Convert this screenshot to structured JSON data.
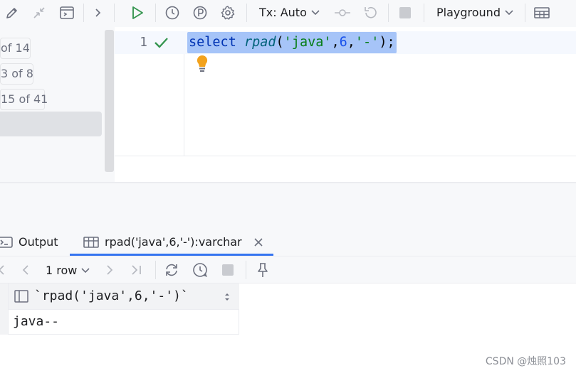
{
  "toolbar": {
    "tx_mode": "Tx: Auto",
    "session": "Playground",
    "colors": {
      "run": "#369650",
      "icon": "#6c707e",
      "disabled": "#b5b8bf"
    }
  },
  "structure_panel": {
    "counts": [
      "of 14",
      "3 of 8",
      "15 of 41"
    ]
  },
  "editor": {
    "line_number": "1",
    "code_tokens": [
      {
        "text": "select",
        "type": "kw"
      },
      {
        "text": " ",
        "type": "punc"
      },
      {
        "text": "rpad",
        "type": "fn"
      },
      {
        "text": "(",
        "type": "punc"
      },
      {
        "text": "'java'",
        "type": "str"
      },
      {
        "text": ",",
        "type": "punc"
      },
      {
        "text": "6",
        "type": "num"
      },
      {
        "text": ",",
        "type": "punc"
      },
      {
        "text": "'-'",
        "type": "str"
      },
      {
        "text": ");",
        "type": "punc"
      }
    ],
    "status_icon": "check-icon",
    "hint_icon": "lightbulb-icon"
  },
  "results": {
    "tabs": [
      {
        "label": "Output",
        "icon": "console-icon"
      },
      {
        "label": "rpad('java',6,'-'):varchar",
        "icon": "table-icon",
        "active": true
      }
    ],
    "row_count": "1 row",
    "columns": [
      "`rpad('java',6,'-')`"
    ],
    "rows": [
      [
        "java--"
      ]
    ]
  },
  "watermark": "CSDN @烛照103"
}
